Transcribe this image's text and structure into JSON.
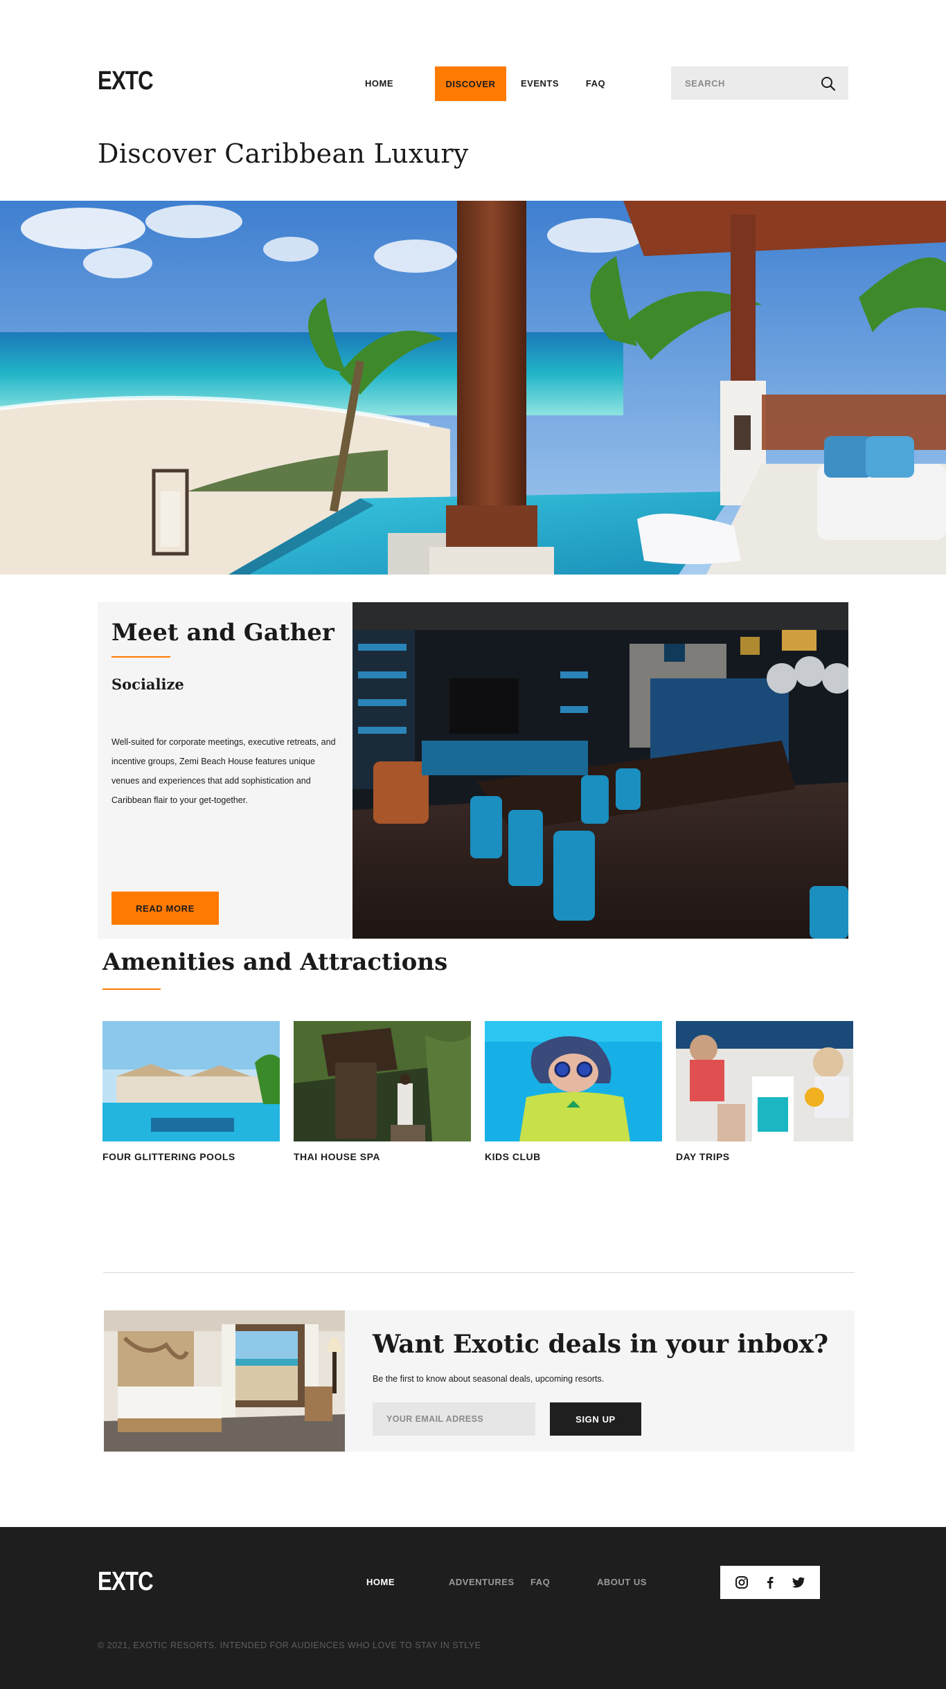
{
  "header": {
    "logo": "EXTC",
    "nav": [
      {
        "label": "HOME",
        "active": false
      },
      {
        "label": "DISCOVER",
        "active": true
      },
      {
        "label": "EVENTS",
        "active": false
      },
      {
        "label": "FAQ",
        "active": false
      }
    ],
    "search_placeholder": "SEARCH"
  },
  "page_title": "Discover Caribbean Luxury",
  "meet": {
    "title": "Meet and Gather",
    "subtitle": "Socialize",
    "body": "Well-suited for corporate meetings, executive retreats, and incentive groups, Zemi Beach House features unique venues and experiences that add sophistication and Caribbean flair to your get-together.",
    "button": "READ MORE"
  },
  "amenities": {
    "title": "Amenities and Attractions",
    "items": [
      {
        "label": "FOUR GLITTERING POOLS"
      },
      {
        "label": "THAI HOUSE SPA"
      },
      {
        "label": "KIDS CLUB"
      },
      {
        "label": "DAY TRIPS"
      }
    ]
  },
  "newsletter": {
    "title": "Want Exotic deals in your inbox?",
    "subtitle": "Be the first to know about seasonal deals, upcoming resorts.",
    "email_placeholder": "YOUR EMAIL ADRESS",
    "button": "SIGN UP"
  },
  "footer": {
    "logo": "EXTC",
    "nav": [
      {
        "label": "HOME"
      },
      {
        "label": "ADVENTURES"
      },
      {
        "label": "FAQ"
      },
      {
        "label": "ABOUT US"
      }
    ],
    "social": [
      "instagram-icon",
      "facebook-icon",
      "twitter-icon"
    ],
    "copyright": "© 2021, EXOTIC RESORTS. INTENDED FOR AUDIENCES WHO LOVE TO STAY IN STLYE"
  },
  "colors": {
    "accent": "#ff7a00",
    "dark": "#1e1e1e",
    "panel": "#f5f5f5"
  }
}
